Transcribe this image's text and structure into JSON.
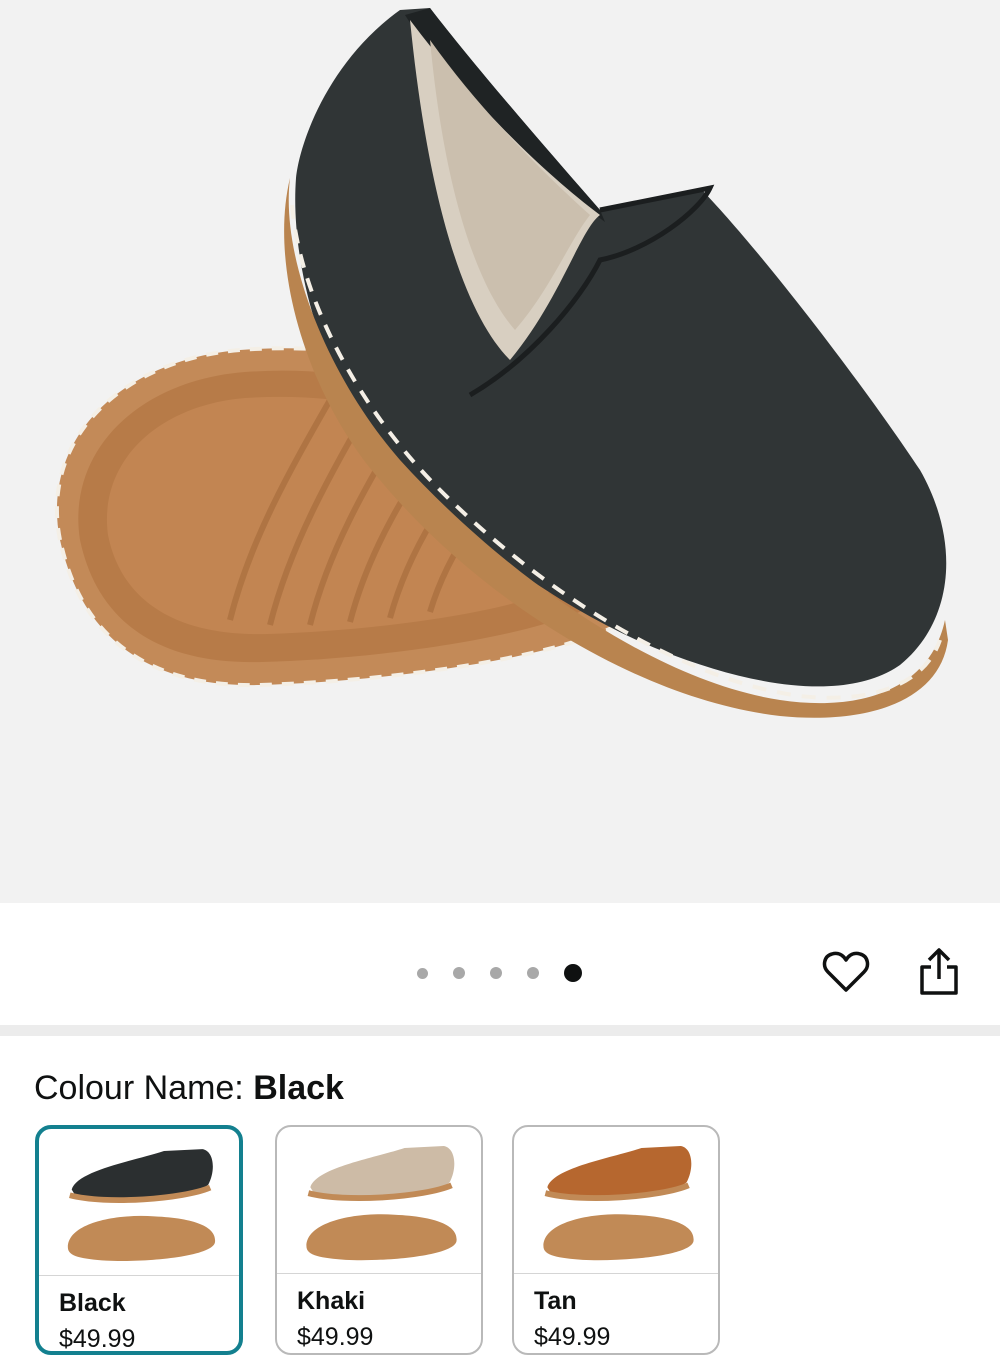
{
  "product": {
    "image_alt": "Black slip-on leather shoe with tan stitched sole",
    "carousel": {
      "total": 5,
      "active_index": 5
    }
  },
  "actions": {
    "wishlist_icon": "heart-outline-icon",
    "share_icon": "share-icon"
  },
  "colour": {
    "label": "Colour Name: ",
    "selected": "Black"
  },
  "swatches": [
    {
      "name": "Black",
      "price": "$49.99",
      "upper_color": "#2b2f30",
      "selected": true
    },
    {
      "name": "Khaki",
      "price": "$49.99",
      "upper_color": "#cdbba6",
      "selected": false
    },
    {
      "name": "Tan",
      "price": "$49.99",
      "upper_color": "#b6672f",
      "selected": false
    }
  ],
  "colors": {
    "accent": "#13808f",
    "sole": "#c18a56",
    "background": "#f2f2f2"
  }
}
